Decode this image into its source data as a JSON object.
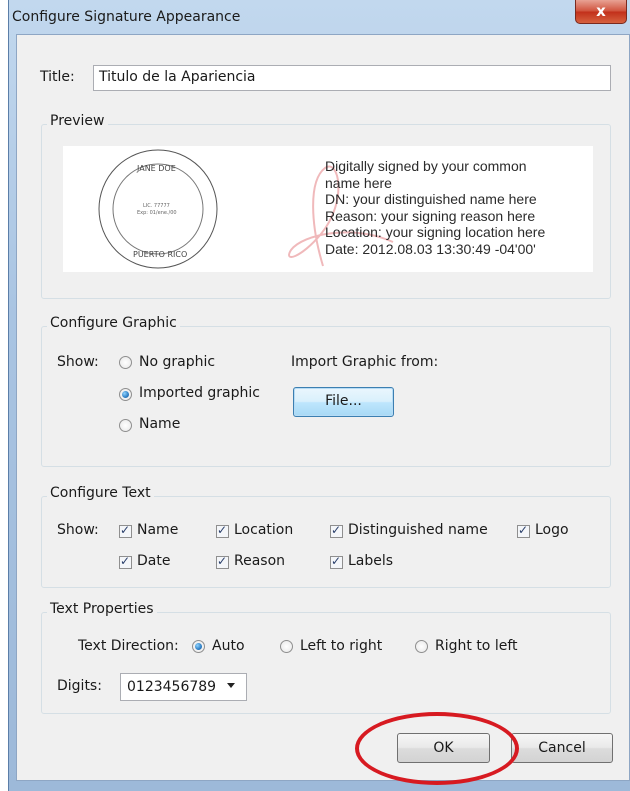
{
  "window": {
    "title": "Configure Signature Appearance",
    "close_glyph": "x"
  },
  "title_field": {
    "label": "Title:",
    "value": "Titulo de la Apariencia"
  },
  "preview": {
    "group_title": "Preview",
    "seal": {
      "top_text": "JANE DOE",
      "bottom_text": "PUERTO RICO",
      "center_line1": "LIC. 77777",
      "center_line2": "Exp: 01/ene./00"
    },
    "lines": [
      "Digitally signed by your common",
      "name here",
      "DN: your distinguished name here",
      "Reason: your signing reason here",
      "Location: your signing location here",
      "Date: 2012.08.03 13:30:49 -04'00'"
    ]
  },
  "configure_graphic": {
    "group_title": "Configure Graphic",
    "show_label": "Show:",
    "options": [
      {
        "label": "No graphic",
        "selected": false
      },
      {
        "label": "Imported graphic",
        "selected": true
      },
      {
        "label": "Name",
        "selected": false
      }
    ],
    "import_label": "Import Graphic from:",
    "file_button": "File..."
  },
  "configure_text": {
    "group_title": "Configure Text",
    "show_label": "Show:",
    "checkboxes": [
      {
        "label": "Name",
        "checked": true
      },
      {
        "label": "Location",
        "checked": true
      },
      {
        "label": "Distinguished name",
        "checked": true
      },
      {
        "label": "Logo",
        "checked": true
      },
      {
        "label": "Date",
        "checked": true
      },
      {
        "label": "Reason",
        "checked": true
      },
      {
        "label": "Labels",
        "checked": true
      }
    ]
  },
  "text_properties": {
    "group_title": "Text Properties",
    "direction_label": "Text Direction:",
    "directions": [
      {
        "label": "Auto",
        "selected": true
      },
      {
        "label": "Left to right",
        "selected": false
      },
      {
        "label": "Right to left",
        "selected": false
      }
    ],
    "digits_label": "Digits:",
    "digits_value": "0123456789"
  },
  "buttons": {
    "ok": "OK",
    "cancel": "Cancel"
  },
  "colors": {
    "highlight": "#d71a21",
    "titlebar": "#a9c4e2",
    "close": "#c2301b"
  }
}
